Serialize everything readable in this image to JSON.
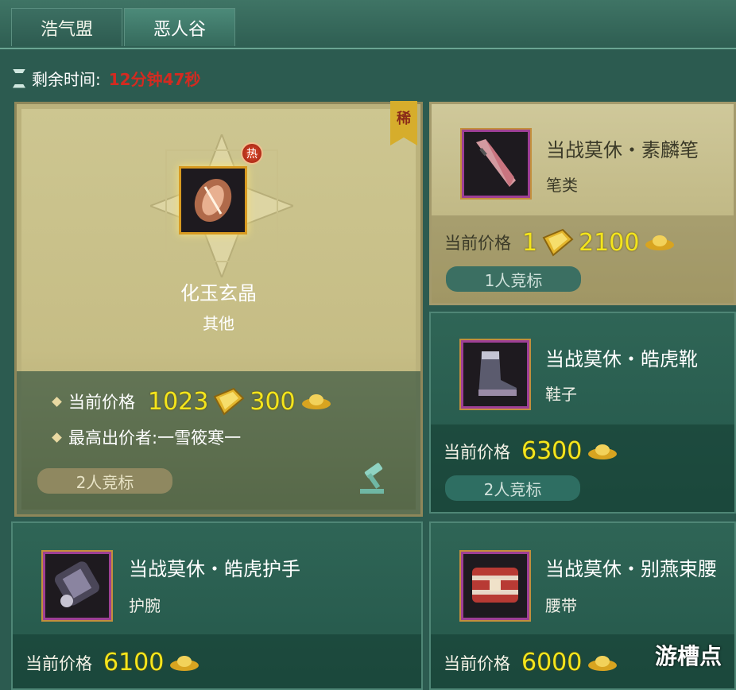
{
  "tabs": [
    {
      "label": "浩气盟",
      "active": false
    },
    {
      "label": "恶人谷",
      "active": true
    }
  ],
  "timer": {
    "label": "剩余时间:",
    "value": "12分钟47秒"
  },
  "featured": {
    "badge": "稀",
    "hot": "热",
    "name": "化玉玄晶",
    "category": "其他",
    "price_label": "当前价格",
    "price_gold_bars": "1023",
    "price_gold": "300",
    "top_bidder_label": "最高出价者:",
    "top_bidder": "一雪筱寒一",
    "bids": "2人竞标",
    "bid_icon": "gavel-icon"
  },
  "items": [
    {
      "name": "当战莫休・素麟笔",
      "category": "笔类",
      "price_label": "当前价格",
      "gold_bars": "1",
      "gold": "2100",
      "bids": "1人竞标",
      "icon": "brush-icon"
    },
    {
      "name": "当战莫休・皓虎靴",
      "category": "鞋子",
      "price_label": "当前价格",
      "gold": "6300",
      "bids": "2人竞标",
      "icon": "boot-icon"
    },
    {
      "name": "当战莫休・皓虎护手",
      "category": "护腕",
      "price_label": "当前价格",
      "gold": "6100",
      "icon": "bracer-icon"
    },
    {
      "name": "当战莫休・别燕束腰",
      "category": "腰带",
      "price_label": "当前价格",
      "gold": "6000",
      "icon": "belt-icon"
    }
  ],
  "watermark": "游槽点",
  "colors": {
    "accent_gold": "#f4e51c",
    "timer_red": "#d42a20",
    "panel_teal": "#2c5b50"
  }
}
